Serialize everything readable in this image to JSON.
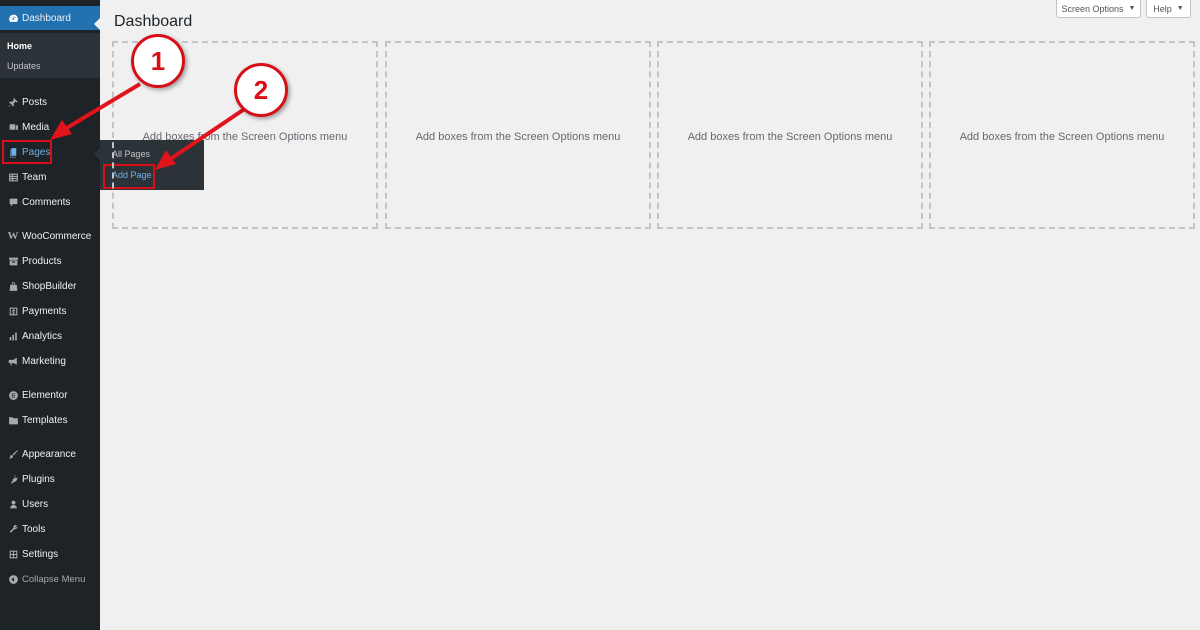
{
  "sidebar": {
    "dashboard": {
      "label": "Dashboard",
      "icon": "dashboard-icon"
    },
    "submenu": {
      "home": "Home",
      "updates": "Updates"
    },
    "items": [
      {
        "label": "Posts",
        "icon": "pin-icon"
      },
      {
        "label": "Media",
        "icon": "media-icon"
      },
      {
        "label": "Pages",
        "icon": "pages-icon"
      },
      {
        "label": "Team",
        "icon": "team-icon"
      },
      {
        "label": "Comments",
        "icon": "comment-icon"
      },
      {
        "label": "WooCommerce",
        "icon": "woocommerce-icon"
      },
      {
        "label": "Products",
        "icon": "archive-icon"
      },
      {
        "label": "ShopBuilder",
        "icon": "bag-icon"
      },
      {
        "label": "Payments",
        "icon": "dollar-icon"
      },
      {
        "label": "Analytics",
        "icon": "bar-chart-icon"
      },
      {
        "label": "Marketing",
        "icon": "megaphone-icon"
      },
      {
        "label": "Elementor",
        "icon": "elementor-icon"
      },
      {
        "label": "Templates",
        "icon": "folder-icon"
      },
      {
        "label": "Appearance",
        "icon": "brush-icon"
      },
      {
        "label": "Plugins",
        "icon": "plug-icon"
      },
      {
        "label": "Users",
        "icon": "user-icon"
      },
      {
        "label": "Tools",
        "icon": "wrench-icon"
      },
      {
        "label": "Settings",
        "icon": "settings-icon"
      },
      {
        "label": "Collapse Menu",
        "icon": "collapse-icon"
      }
    ],
    "flyout": {
      "all_pages": "All Pages",
      "add_page": "Add Page"
    }
  },
  "header": {
    "title": "Dashboard",
    "screen_options": "Screen Options",
    "help": "Help",
    "caret": "▼"
  },
  "boxes": [
    "Add boxes from the Screen Options menu",
    "Add boxes from the Screen Options menu",
    "Add boxes from the Screen Options menu",
    "Add boxes from the Screen Options menu"
  ],
  "callouts": {
    "step1": "1",
    "step2": "2"
  },
  "colors": {
    "sidebar": "#1d2327",
    "active": "#2271b1",
    "highlight": "#d70f16",
    "link": "#72aee6"
  }
}
